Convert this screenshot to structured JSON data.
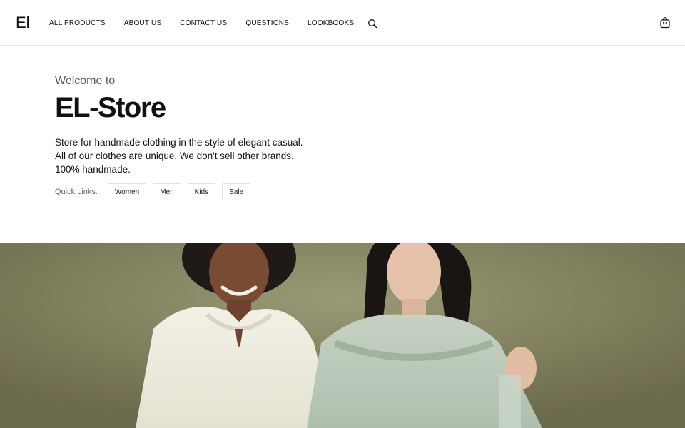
{
  "header": {
    "logo": "El",
    "nav": [
      "ALL PRODUCTS",
      "ABOUT US",
      "CONTACT US",
      "QUESTIONS",
      "LOOKBOOKS"
    ],
    "search_icon": "search-icon",
    "cart_icon": "shopping-bag-icon"
  },
  "hero": {
    "welcome": "Welcome to",
    "title": "EL-Store",
    "description": [
      "Store for handmade clothing in the style of elegant casual.",
      "All of our clothes are unique. We don't sell other brands.",
      "100% handmade."
    ],
    "quick_links_label": "Quick Links:",
    "quick_links": [
      "Women",
      "Men",
      "Kids",
      "Sale"
    ]
  },
  "colors": {
    "background": "#ffffff",
    "text": "#111111",
    "muted": "#555555",
    "border": "#e6e6e6",
    "photo_backdrop": "#8a8a66"
  }
}
